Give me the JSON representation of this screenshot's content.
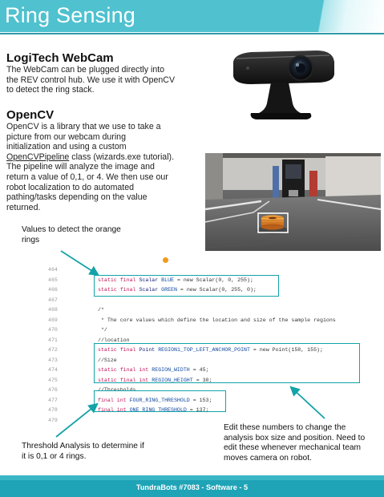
{
  "header": {
    "title": "Ring Sensing"
  },
  "logitech": {
    "heading": "LogiTech WebCam",
    "lines": [
      "The WebCam can be plugged directly into",
      "the REV control hub. We use it with OpenCV",
      "to detect the ring stack."
    ]
  },
  "opencv": {
    "heading": "OpenCV",
    "lines": [
      "OpenCV is a library that we use to take a",
      "picture from our webcam during",
      "initialization and using a custom"
    ],
    "line4_link": "OpenCVPipeline",
    "line4_rest": " class (wizards.exe tutorial).",
    "lines_after": [
      "The pipeline will analyze the image and",
      "return a value of 0,1, or 4. We then use our",
      "robot localization to do automated",
      "pathing/tasks depending on the  value",
      "returned."
    ]
  },
  "annotations": {
    "values_note": [
      "Values to detect the orange",
      "rings"
    ],
    "threshold_note": [
      "Threshold Analysis to determine if",
      "it is 0,1 or 4 rings."
    ],
    "edit_note": [
      "Edit these numbers to change the",
      "analysis box size and position. Need to",
      "edit these whenever mechanical team",
      "moves camera on robot."
    ]
  },
  "code": {
    "lines": [
      {
        "n": "464"
      },
      {
        "n": "465",
        "kw": "static final ",
        "ty": "Scalar ",
        "id": "BLUE",
        "rest": " = new Scalar(0, 0, 255);"
      },
      {
        "n": "466",
        "kw": "static final ",
        "ty": "Scalar ",
        "id": "GREEN",
        "rest": " = new Scalar(0, 255, 0);"
      },
      {
        "n": "467"
      },
      {
        "n": "468",
        "cm": "/*"
      },
      {
        "n": "469",
        "cm": " * The core values which define the location and size of the sample regions"
      },
      {
        "n": "470",
        "cm": " */"
      },
      {
        "n": "471",
        "cm": "//location"
      },
      {
        "n": "472",
        "kw": "static final ",
        "ty": "Point ",
        "id": "REGION1_TOP_LEFT_ANCHOR_POINT",
        "rest": " = new Point(158, 155);"
      },
      {
        "n": "473",
        "cm": "//Size"
      },
      {
        "n": "474",
        "kw": "static final int ",
        "id": "REGION_WIDTH",
        "rest": " = 45;"
      },
      {
        "n": "475",
        "kw": "static final int ",
        "id": "REGION_HEIGHT",
        "rest": " = 30;"
      },
      {
        "n": "476",
        "cm": "//Thresholds"
      },
      {
        "n": "477",
        "kw": "final int ",
        "id": "FOUR_RING_THRESHOLD",
        "rest": " = 153;"
      },
      {
        "n": "478",
        "kw": "final int ",
        "id": "ONE_RING_THRESHOLD",
        "rest": " = 137;"
      },
      {
        "n": "479"
      }
    ]
  },
  "footer": {
    "text": "TundraBots #7083 - Software - 5"
  },
  "colors": {
    "header": "#4fc1cf",
    "footer": "#1fa3b6",
    "annotation": "#13a3a8",
    "ring": "#e8892a",
    "dot": "#f39a1d"
  },
  "icons": {
    "webcam": "webcam-image",
    "photo": "field-camera-photo"
  }
}
